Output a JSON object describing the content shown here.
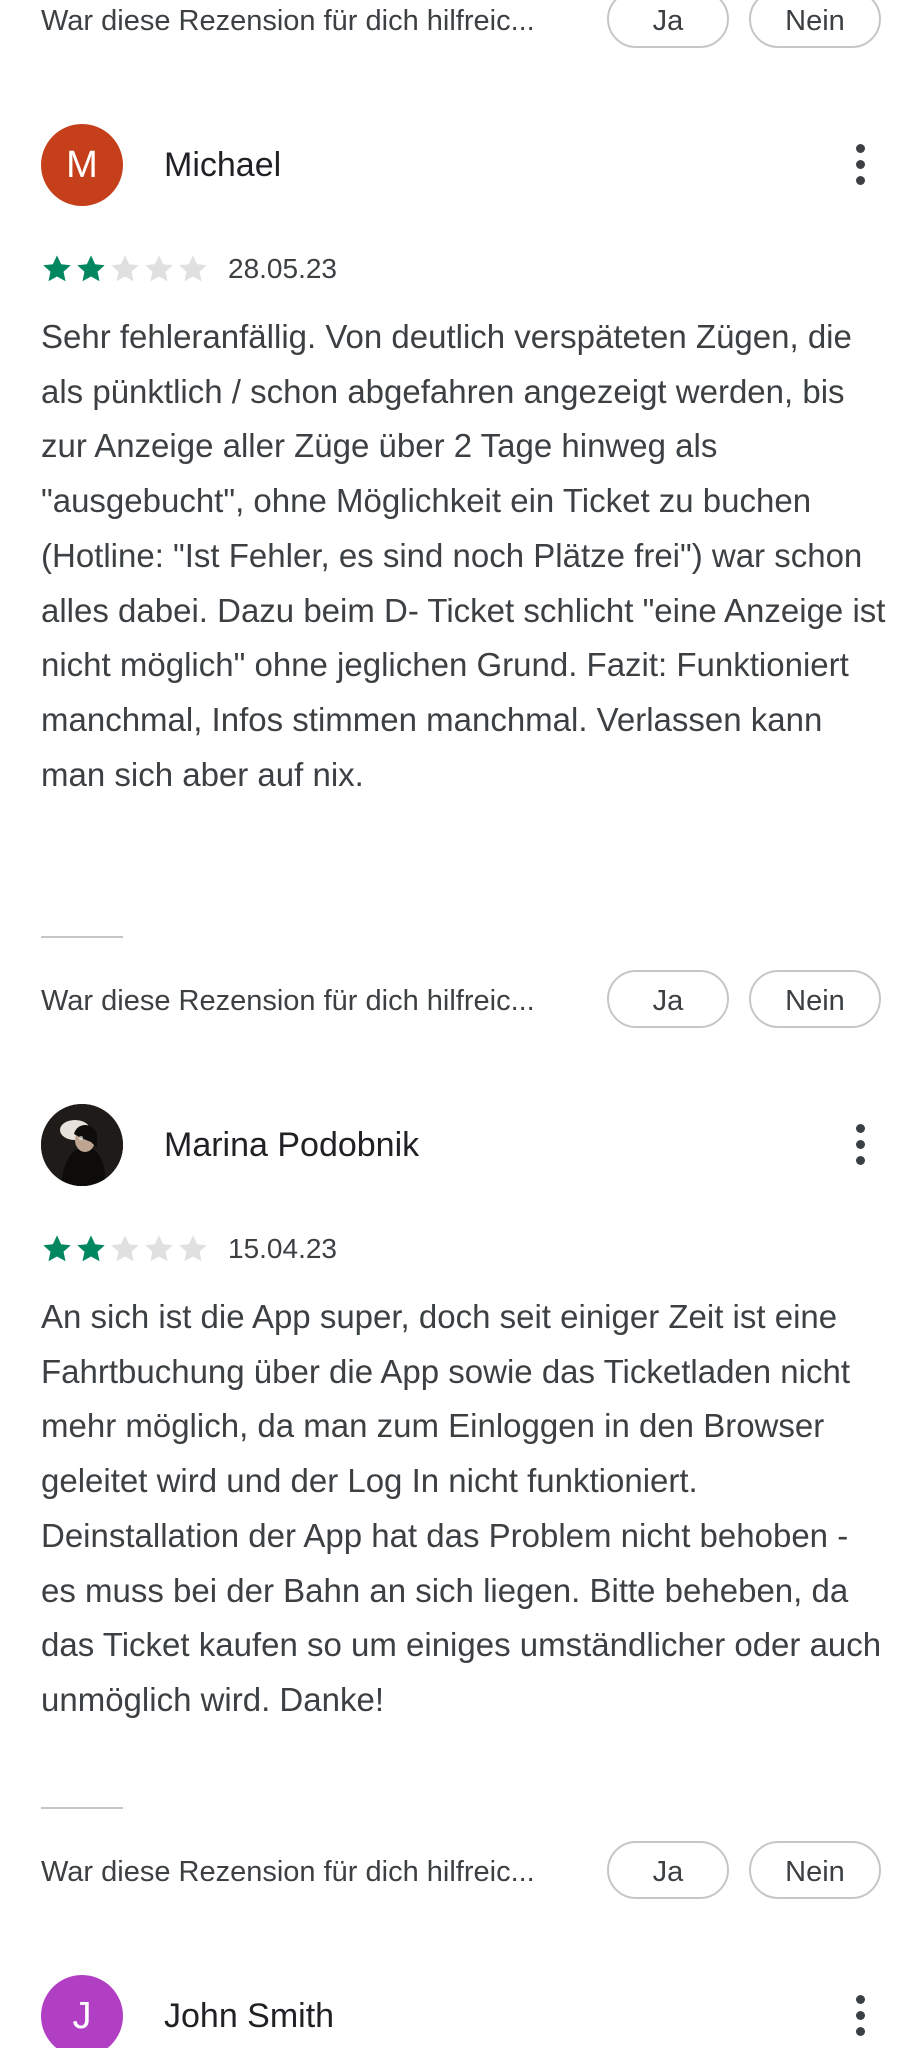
{
  "helpful": {
    "prompt": "War diese Rezension für dich hilfreic...",
    "yes_label": "Ja",
    "no_label": "Nein"
  },
  "reviews": [
    {
      "author": "Michael",
      "avatar_letter": "M",
      "avatar_color": "#c5401a",
      "rating": 2,
      "max_rating": 5,
      "date": "28.05.23",
      "text": "Sehr fehleranfällig. Von deutlich verspäteten Zügen, die als pünktlich / schon abgefahren angezeigt werden, bis zur Anzeige aller Züge über 2 Tage hinweg als \"ausgebucht\", ohne Möglichkeit ein Ticket zu buchen (Hotline: \"Ist Fehler, es sind noch Plätze frei\") war schon alles dabei. Dazu beim D- Ticket schlicht \"eine Anzeige ist nicht möglich\" ohne jeglichen Grund. Fazit: Funktioniert manchmal, Infos stimmen manchmal. Verlassen kann man sich aber auf nix."
    },
    {
      "author": "Marina Podobnik",
      "avatar_letter": "",
      "avatar_color": "#1f1b18",
      "rating": 2,
      "max_rating": 5,
      "date": "15.04.23",
      "text": "An sich ist die App super, doch seit einiger Zeit ist eine Fahrtbuchung über die App sowie das Ticketladen nicht mehr möglich, da man zum Einloggen in den Browser geleitet wird und der Log In nicht funktioniert. Deinstallation der App hat das Problem nicht behoben - es muss bei der Bahn an sich liegen. Bitte beheben, da das Ticket kaufen so um einiges umständlicher oder auch unmöglich wird. Danke!"
    },
    {
      "author": "John Smith",
      "avatar_letter": "J",
      "avatar_color": "#b13fc4"
    }
  ],
  "colors": {
    "star_filled": "#01875f",
    "star_empty": "#e0e0e0"
  },
  "icons": {
    "star": "star-icon",
    "more": "more-vert-icon"
  }
}
